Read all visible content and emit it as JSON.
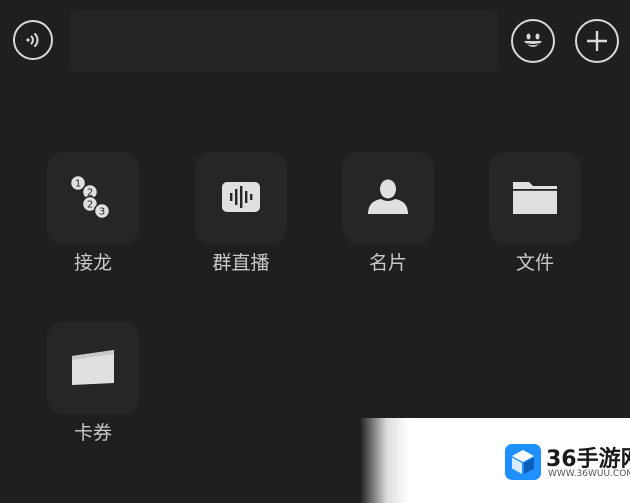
{
  "top_bar": {
    "input_value": "",
    "input_placeholder": ""
  },
  "icons": {
    "voice": "voice-input-icon",
    "emoji": "emoji-icon",
    "plus": "plus-icon"
  },
  "panel": {
    "items": [
      {
        "label": "接龙",
        "icon": "solitaire-icon"
      },
      {
        "label": "群直播",
        "icon": "group-live-icon"
      },
      {
        "label": "名片",
        "icon": "contact-card-icon"
      },
      {
        "label": "文件",
        "icon": "folder-icon"
      },
      {
        "label": "卡券",
        "icon": "coupon-icon"
      }
    ]
  },
  "watermark": {
    "title": "36手游网",
    "url": "WWW.36WUU.COM",
    "accent": "#1e90ff"
  },
  "colors": {
    "background": "#1f1f1f",
    "tile": "#262626",
    "label": "#c8c8c8",
    "icon": "#d9d9d9"
  }
}
